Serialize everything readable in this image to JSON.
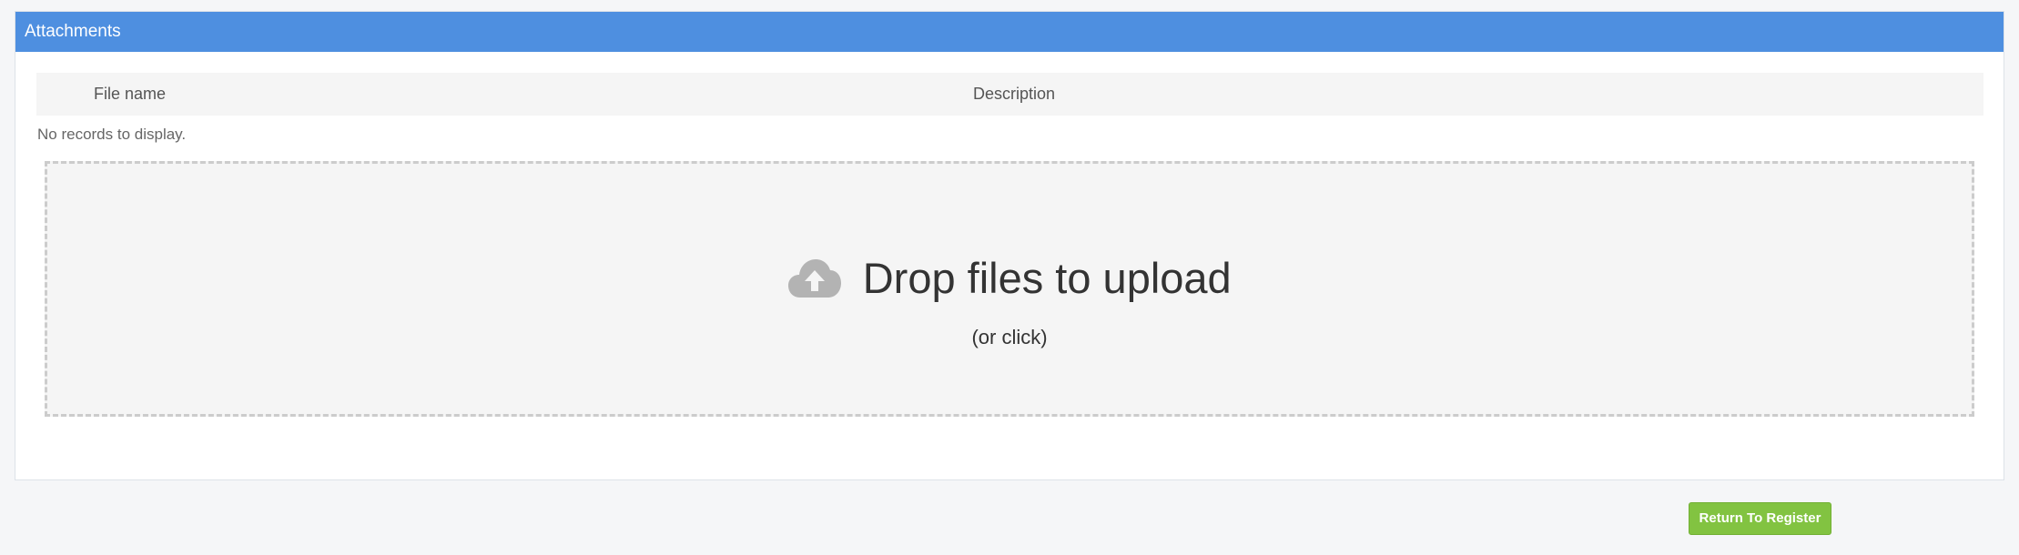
{
  "panel": {
    "title": "Attachments"
  },
  "grid": {
    "columns": [
      {
        "label": "File name"
      },
      {
        "label": "Description"
      }
    ],
    "empty_message": "No records to display."
  },
  "dropzone": {
    "icon": "cloud-upload-icon",
    "title": "Drop files to upload",
    "subtitle": "(or click)"
  },
  "actions": {
    "return_label": "Return To Register"
  },
  "colors": {
    "header_blue": "#4e8fe0",
    "button_green": "#82c341",
    "dropzone_bg": "#f5f5f5"
  }
}
